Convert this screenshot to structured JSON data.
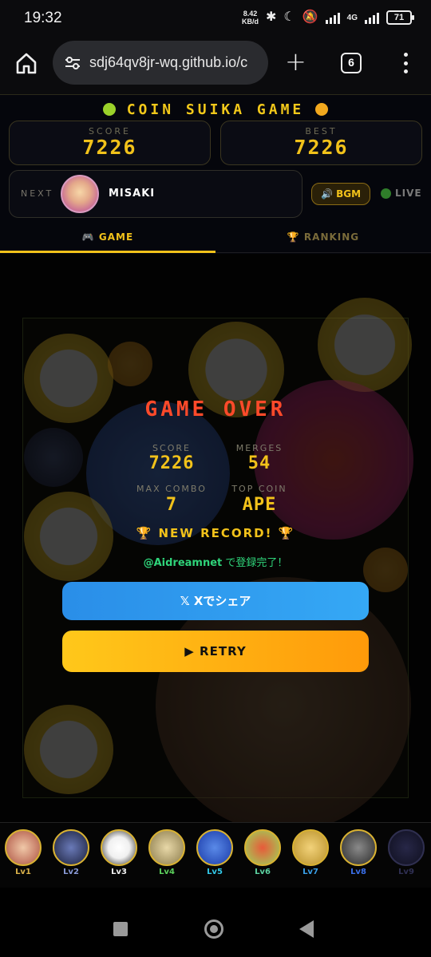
{
  "status_bar": {
    "time": "19:32",
    "net_speed_value": "8.42",
    "net_speed_unit": "KB/d",
    "network": "4G",
    "battery": "71"
  },
  "browser": {
    "url": "sdj64qv8jr-wq.github.io/c",
    "tab_count": "6"
  },
  "app": {
    "title": "COIN SUIKA GAME",
    "score_label": "SCORE",
    "score_value": "7226",
    "best_label": "BEST",
    "best_value": "7226",
    "next_label": "NEXT",
    "next_name": "MISAKI",
    "bgm_label": "🔊 BGM",
    "live_label": "LIVE",
    "tabs": [
      {
        "label": "🎮 GAME",
        "active": true
      },
      {
        "label": "🏆 RANKING",
        "active": false
      }
    ]
  },
  "game_over": {
    "title": "GAME OVER",
    "stats": [
      {
        "label": "SCORE",
        "value": "7226"
      },
      {
        "label": "MERGES",
        "value": "54"
      },
      {
        "label": "MAX COMBO",
        "value": "7"
      },
      {
        "label": "TOP COIN",
        "value": "APE"
      }
    ],
    "record_text": "🏆 NEW RECORD! 🏆",
    "registered_handle": "@Aidreamnet",
    "registered_text": " で登録完了！",
    "share_label": "𝕏  Xでシェア",
    "retry_label": "▶ RETRY"
  },
  "levels": [
    {
      "label": "Lv1",
      "color": "#d9b14a"
    },
    {
      "label": "Lv2",
      "color": "#8a9bd8"
    },
    {
      "label": "Lv3",
      "color": "#f2f2f2"
    },
    {
      "label": "Lv4",
      "color": "#5cd15c"
    },
    {
      "label": "Lv5",
      "color": "#32c8e8"
    },
    {
      "label": "Lv6",
      "color": "#5cd1a0"
    },
    {
      "label": "Lv7",
      "color": "#3aa0e8"
    },
    {
      "label": "Lv8",
      "color": "#3a6ee8"
    },
    {
      "label": "Lv9",
      "color": "#3a3a7a"
    }
  ]
}
